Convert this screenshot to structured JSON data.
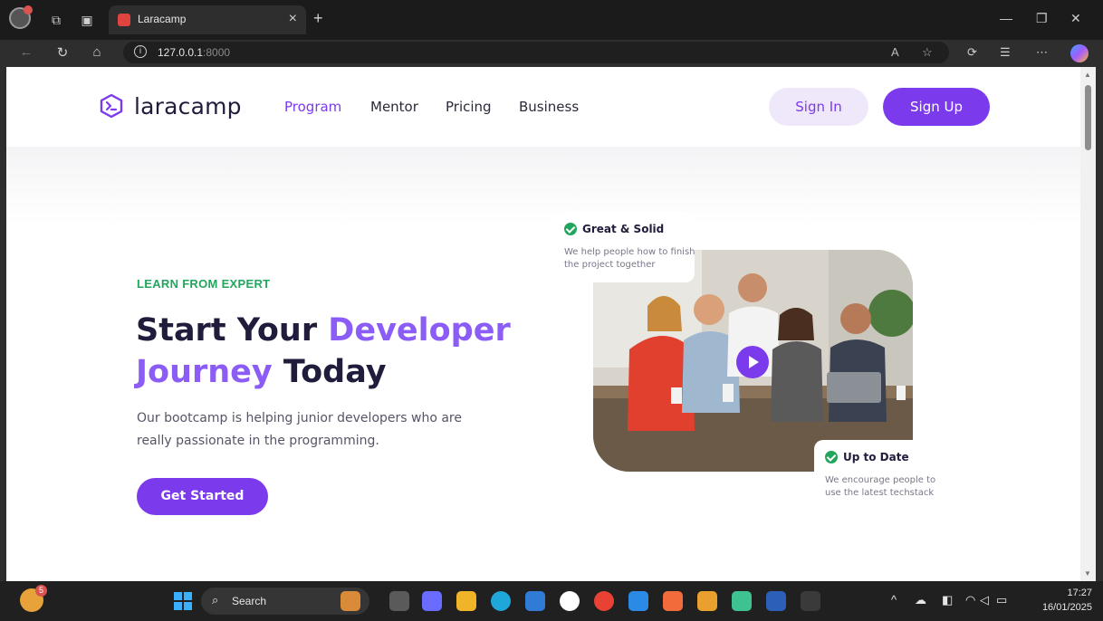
{
  "browser": {
    "tab_title": "Laracamp",
    "url_host": "127.0.0.1",
    "url_port": ":8000"
  },
  "site": {
    "brand": "laracamp",
    "nav": [
      "Program",
      "Mentor",
      "Pricing",
      "Business"
    ],
    "active_nav": "Program",
    "sign_in": "Sign In",
    "sign_up": "Sign Up"
  },
  "hero": {
    "kicker": "LEARN FROM EXPERT",
    "headline_1": "Start Your ",
    "headline_highlight_1": "Developer",
    "headline_highlight_2": "Journey",
    "headline_2": " Today",
    "description": "Our bootcamp is helping junior developers who are really passionate in the programming.",
    "cta": "Get Started",
    "card_top_title": "Great & Solid",
    "card_top_text": "We help people how to finish the project together",
    "card_bottom_title": "Up to Date",
    "card_bottom_text": "We encourage people to use the latest techstack"
  },
  "taskbar": {
    "search_label": "Search",
    "widget_badge": "5",
    "time": "17:27",
    "date": "16/01/2025"
  },
  "colors": {
    "brand_purple": "#7c3aed",
    "accent_green": "#22a65e"
  }
}
